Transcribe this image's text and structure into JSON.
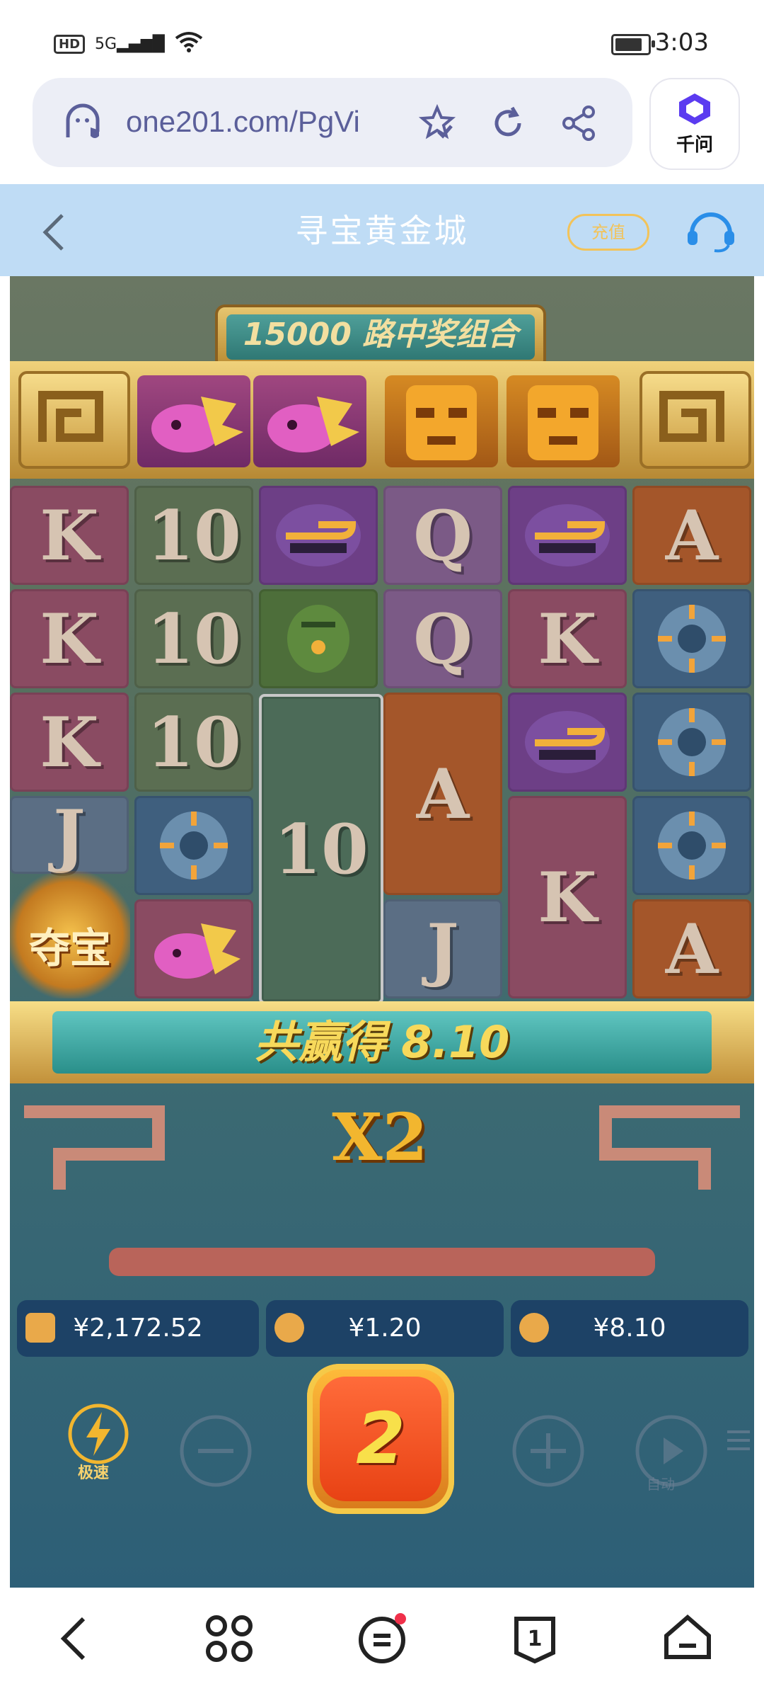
{
  "status_bar": {
    "hd": "HD",
    "network": "5G",
    "time": "3:03",
    "battery_level": 0.85
  },
  "browser": {
    "url": "one201.com/PgVi",
    "assistant_label": "千问"
  },
  "header": {
    "title": "寻宝黄金城",
    "recharge_label": "充值"
  },
  "game": {
    "banner_text": "15000 路中奖组合",
    "top_symbols": [
      "pink-bird",
      "pink-bird",
      "gold-mask",
      "gold-mask"
    ],
    "treasure_label": "夺宝",
    "win_text": "共赢得 8.10",
    "multiplier": "X2",
    "balance": "¥2,172.52",
    "bet": "¥1.20",
    "win": "¥8.10",
    "spin_label": "2",
    "turbo_label": "极速",
    "auto_label": "自动",
    "grid": {
      "col1": [
        "K",
        "K",
        "K",
        "J"
      ],
      "col2": [
        "10",
        "10",
        "10"
      ],
      "col3_big": "10",
      "col4": [
        "Q",
        "Q",
        "A",
        "J"
      ],
      "col5": [
        "K",
        "K"
      ],
      "col6": [
        "A",
        "A"
      ]
    }
  },
  "colors": {
    "header_bg": "#bfdcf5",
    "gold": "#f2b62f",
    "spin": "#e84214"
  }
}
